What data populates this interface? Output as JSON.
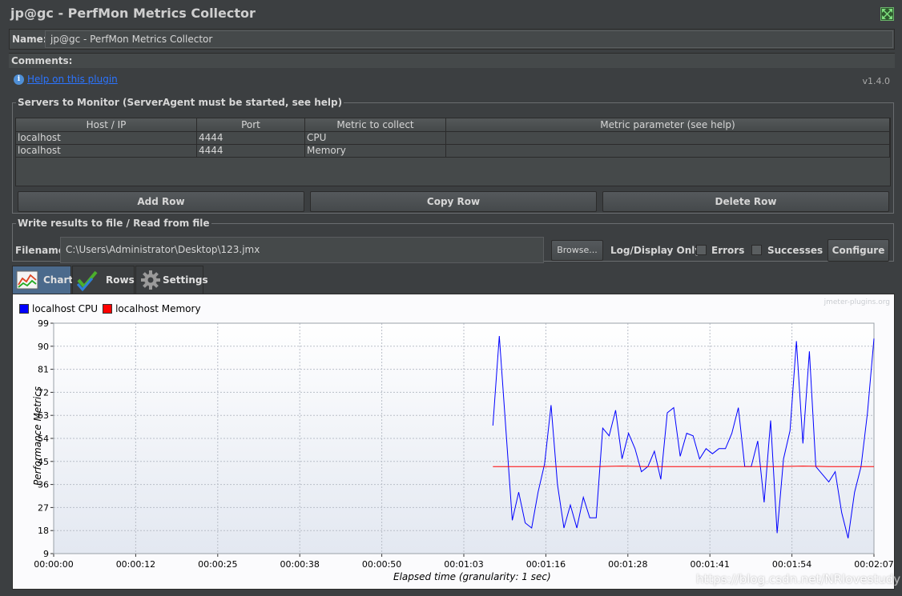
{
  "window": {
    "title": "jp@gc - PerfMon Metrics Collector"
  },
  "name_field": {
    "label": "Name:",
    "value": "jp@gc - PerfMon Metrics Collector"
  },
  "comments": {
    "label": "Comments:"
  },
  "help": {
    "link": "Help on this plugin",
    "version": "v1.4.0"
  },
  "servers": {
    "legend": "Servers to Monitor (ServerAgent must be started, see help)",
    "columns": [
      "Host / IP",
      "Port",
      "Metric to collect",
      "Metric parameter (see help)"
    ],
    "rows": [
      [
        "localhost",
        "4444",
        "CPU",
        ""
      ],
      [
        "localhost",
        "4444",
        "Memory",
        ""
      ]
    ],
    "add_row": "Add Row",
    "copy_row": "Copy Row",
    "delete_row": "Delete Row"
  },
  "file": {
    "legend": "Write results to file / Read from file",
    "filename_label": "Filename",
    "filename_value": "C:\\Users\\Administrator\\Desktop\\123.jmx",
    "browse": "Browse...",
    "log_display_only": "Log/Display Only:",
    "errors": "Errors",
    "successes": "Successes",
    "configure": "Configure"
  },
  "tabs": [
    {
      "label": "Chart",
      "icon": "chart-icon",
      "active": true
    },
    {
      "label": "Rows",
      "icon": "checkmarks-icon",
      "active": false
    },
    {
      "label": "Settings",
      "icon": "gear-icon",
      "active": false
    }
  ],
  "chart_panel": {
    "watermark": "jmeter-plugins.org",
    "overlay_watermark": "https://blog.csdn.net/NRlovestudy"
  },
  "chart_data": {
    "type": "line",
    "ylabel": "Performance Metrics",
    "xlabel": "Elapsed time (granularity: 1 sec)",
    "ylim": [
      9,
      99
    ],
    "xlim_seconds": [
      0,
      127
    ],
    "yticks": [
      9,
      18,
      27,
      36,
      45,
      54,
      63,
      72,
      81,
      90,
      99
    ],
    "xticks": [
      "00:00:00",
      "00:00:12",
      "00:00:25",
      "00:00:38",
      "00:00:50",
      "00:01:03",
      "00:01:16",
      "00:01:28",
      "00:01:41",
      "00:01:54",
      "00:02:07"
    ],
    "grid": true,
    "legend_position": "top-left",
    "series": [
      {
        "name": "localhost CPU",
        "color": "#0000ff",
        "x": [
          68,
          69,
          70,
          71,
          72,
          73,
          74,
          75,
          76,
          77,
          78,
          79,
          80,
          81,
          82,
          83,
          84,
          85,
          86,
          87,
          88,
          89,
          90,
          91,
          92,
          93,
          94,
          95,
          96,
          97,
          98,
          99,
          100,
          101,
          102,
          103,
          104,
          105,
          106,
          107,
          108,
          109,
          110,
          111,
          112,
          113,
          114,
          115,
          116,
          117,
          118,
          119,
          120,
          121,
          122,
          123,
          124,
          125,
          126,
          127
        ],
        "values": [
          59,
          94,
          58,
          22,
          33,
          21,
          19,
          33,
          44,
          67,
          36,
          19,
          28,
          19,
          31,
          23,
          23,
          58,
          55,
          65,
          46,
          56,
          50,
          41,
          43,
          49,
          38,
          64,
          66,
          47,
          56,
          55,
          46,
          50,
          48,
          50,
          50,
          56,
          66,
          43,
          43,
          53,
          29,
          61,
          17,
          46,
          57,
          92,
          52,
          88,
          43,
          40,
          37,
          41,
          25,
          15,
          33,
          43,
          64,
          93
        ]
      },
      {
        "name": "localhost Memory",
        "color": "#ff0000",
        "x": [
          68,
          72,
          76,
          80,
          84,
          88,
          92,
          96,
          100,
          104,
          108,
          112,
          116,
          120,
          124,
          127
        ],
        "values": [
          43,
          43,
          43,
          43,
          43,
          43.2,
          43,
          43,
          43,
          43,
          43,
          43,
          43.2,
          43,
          43,
          43
        ]
      }
    ]
  }
}
